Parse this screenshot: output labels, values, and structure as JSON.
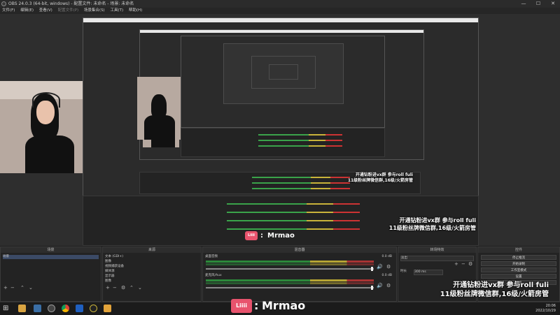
{
  "window": {
    "title": "OBS 24.0.3 (64-bit, windows) - 配置文件: 未命名 - 场景: 未命名",
    "controls": [
      "—",
      "☐",
      "✕"
    ]
  },
  "menu": {
    "items": [
      "文件(F)",
      "编辑(E)",
      "查看(V)",
      "配置文件(P)",
      "场景集合(S)",
      "工具(T)",
      "帮助(H)"
    ]
  },
  "overlay": {
    "brand_badge": "Liiii",
    "brand_sep": ":",
    "brand_name": "Mrmao",
    "line1": "开通钻粉进vx群 参与roll fuli",
    "line2": "11级粉丝牌微信群,16级/火箭房管"
  },
  "docks": {
    "scenes": {
      "title": "场景",
      "items": [
        "场景"
      ]
    },
    "sources": {
      "title": "来源",
      "items": [
        "文本 (GDI+)",
        "图像",
        "视频捕获设备",
        "媒体源",
        "显示器",
        "图像"
      ]
    },
    "mixer": {
      "title": "混音器",
      "channels": [
        {
          "name": "桌面音频",
          "db": "0.0 dB"
        },
        {
          "name": "麦克风/Aux",
          "db": "0.0 dB"
        }
      ]
    },
    "transitions": {
      "title": "转场特效",
      "type": "淡出",
      "duration_label": "时长",
      "duration_value": "300 ms"
    },
    "controls": {
      "title": "控件",
      "buttons": [
        "停止推流",
        "开始录制",
        "工作室模式",
        "设置",
        "退出"
      ]
    }
  },
  "taskbar": {
    "time": "20:06",
    "date": "2022/10/29"
  },
  "colors": {
    "accent_pink": "#e8536d",
    "meter_green": "#2c8a3b",
    "meter_yellow": "#b7a533",
    "meter_red": "#a33"
  }
}
